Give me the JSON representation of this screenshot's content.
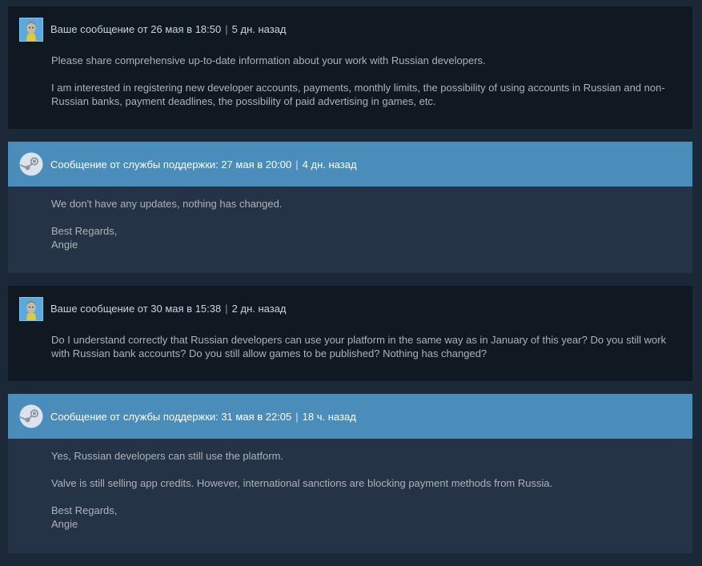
{
  "messages": [
    {
      "type": "user",
      "header": "Ваше сообщение от 26 мая в 18:50",
      "ago": "5 дн. назад",
      "paragraphs": [
        "Please share comprehensive up-to-date information about your work with Russian developers.",
        "I am interested in registering new developer accounts, payments, monthly limits, the possibility of using accounts in Russian and non-Russian banks, payment deadlines, the possibility of paid advertising in games, etc."
      ]
    },
    {
      "type": "support",
      "header": "Сообщение от службы поддержки: 27 мая в 20:00",
      "ago": "4 дн. назад",
      "paragraphs": [
        "We don't have any updates, nothing has changed.",
        "Best Regards,",
        "Angie"
      ]
    },
    {
      "type": "user",
      "header": "Ваше сообщение от 30 мая в 15:38",
      "ago": "2 дн. назад",
      "paragraphs": [
        "Do I understand correctly that Russian developers can use your platform in the same way as in January of this year? Do you still work with Russian bank accounts? Do you still allow games to be published? Nothing has changed?"
      ]
    },
    {
      "type": "support",
      "header": "Сообщение от службы поддержки: 31 мая в 22:05",
      "ago": "18 ч. назад",
      "paragraphs": [
        "Yes, Russian developers can still use the platform.",
        "Valve is still selling app credits. However, international sanctions are blocking payment methods from Russia.",
        "Best Regards,",
        "Angie"
      ]
    }
  ],
  "icons": {
    "user_avatar": "user-avatar-icon",
    "support_avatar": "steam-logo-icon"
  }
}
